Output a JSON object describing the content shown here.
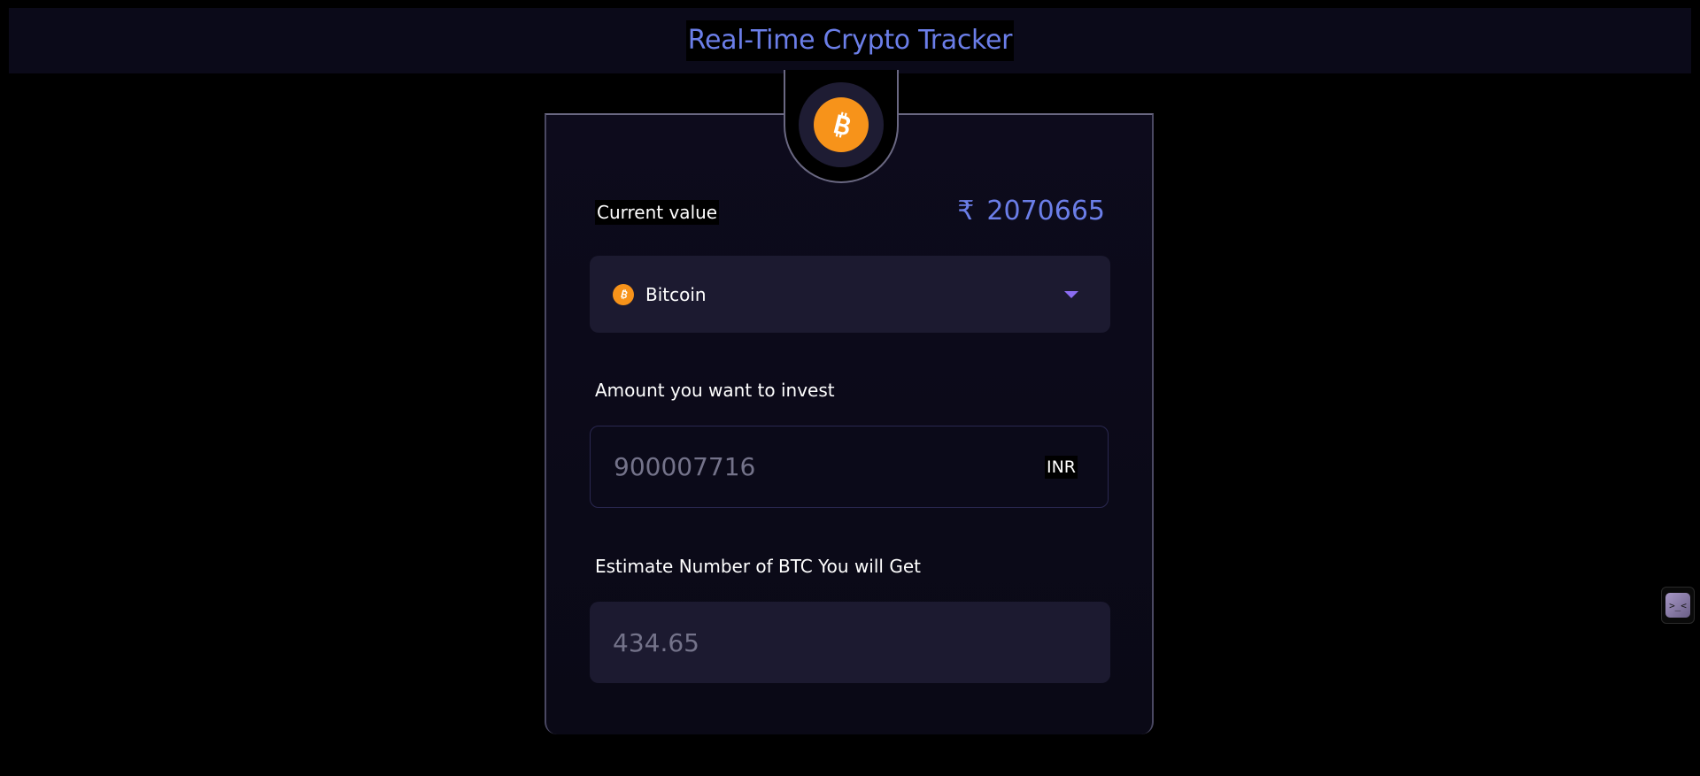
{
  "header": {
    "title": "Real-Time Crypto Tracker"
  },
  "coin_badge": {
    "icon": "bitcoin-icon",
    "color": "#f7931a"
  },
  "current_value": {
    "label": "Current value",
    "currency_symbol": "₹",
    "amount": "2070665"
  },
  "coin_select": {
    "icon": "bitcoin-icon",
    "selected": "Bitcoin"
  },
  "invest": {
    "label": "Amount you want to invest",
    "value": "900007716",
    "currency": "INR"
  },
  "estimate": {
    "label": "Estimate Number of BTC You will Get",
    "value": "434.65"
  },
  "widget": {
    "icon": "assistant-face-icon",
    "glyph": ">_<"
  },
  "colors": {
    "accent": "#6b7ee8",
    "caret": "#8b6cf2",
    "bitcoin": "#f7931a",
    "panel": "#1c1a30"
  }
}
